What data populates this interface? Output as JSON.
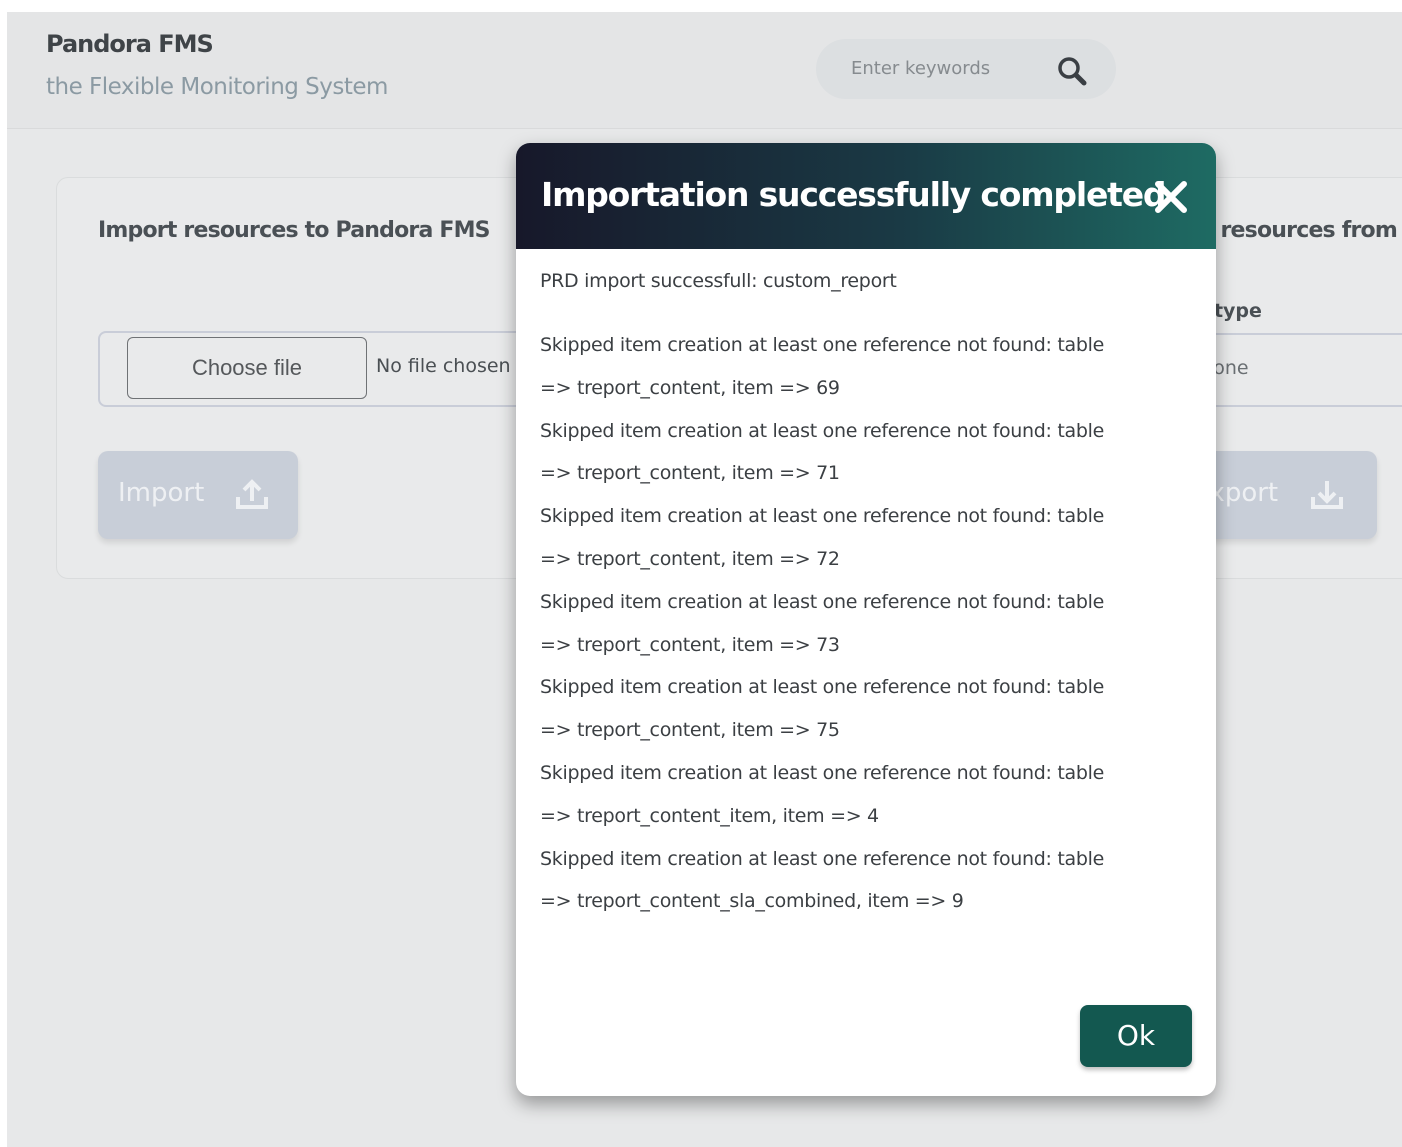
{
  "header": {
    "title": "Pandora FMS",
    "subtitle": "the Flexible Monitoring System",
    "search_placeholder": "Enter keywords"
  },
  "import_section": {
    "title": "Import resources to Pandora FMS",
    "choose_file_label": "Choose file",
    "file_status": "No file chosen",
    "import_label": "Import"
  },
  "export_section": {
    "title": "Export resources from Pandora FMS",
    "type_label": "Export type",
    "type_value": "None",
    "export_label": "Export"
  },
  "dialog": {
    "title": "Importation successfully completed",
    "header": "PRD import successfull: custom_report",
    "lines": [
      "Skipped item creation at least one reference not found: table",
      "=> treport_content, item => 69",
      "Skipped item creation at least one reference not found: table",
      "=> treport_content, item => 71",
      "Skipped item creation at least one reference not found: table",
      "=> treport_content, item => 72",
      "Skipped item creation at least one reference not found: table",
      "=> treport_content, item => 73",
      "Skipped item creation at least one reference not found: table",
      "=> treport_content, item => 75",
      "Skipped item creation at least one reference not found: table",
      "=> treport_content_item, item => 4",
      "Skipped item creation at least one reference not found: table",
      "=> treport_content_sla_combined, item => 9"
    ],
    "ok_label": "Ok"
  },
  "colors": {
    "dialog_header_start": "#17182a",
    "dialog_header_end": "#1e6b63",
    "ok_button": "#135850",
    "disabled_button": "#c8ced8"
  },
  "icons": {
    "search": "search-icon",
    "close": "close-icon",
    "import": "upload-icon",
    "export": "download-icon"
  }
}
